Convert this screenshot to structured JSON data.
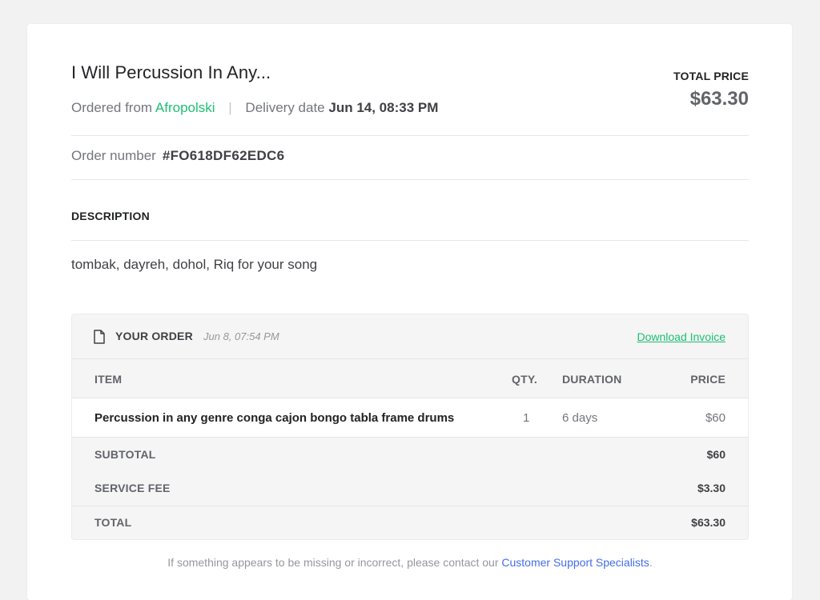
{
  "order": {
    "title": "I Will Percussion In Any...",
    "ordered_from_label": "Ordered from",
    "seller": "Afropolski",
    "separator": "|",
    "delivery_label": "Delivery date",
    "delivery_date": "Jun 14, 08:33 PM",
    "total_price_label": "TOTAL PRICE",
    "total_price": "$63.30",
    "order_number_label": "Order number",
    "order_number": "#FO618DF62EDC6"
  },
  "description": {
    "heading": "DESCRIPTION",
    "text": "tombak, dayreh, dohol, Riq for your song"
  },
  "your_order": {
    "heading": "YOUR ORDER",
    "date": "Jun 8, 07:54 PM",
    "download_label": "Download Invoice",
    "columns": {
      "item": "ITEM",
      "qty": "QTY.",
      "duration": "DURATION",
      "price": "PRICE"
    },
    "items": [
      {
        "name": "Percussion in any genre conga cajon bongo tabla frame drums",
        "qty": "1",
        "duration": "6 days",
        "price": "$60"
      }
    ],
    "subtotal_label": "SUBTOTAL",
    "subtotal": "$60",
    "service_fee_label": "SERVICE FEE",
    "service_fee": "$3.30",
    "total_label": "TOTAL",
    "total": "$63.30"
  },
  "footer": {
    "text": "If something appears to be missing or incorrect, please contact our",
    "link": "Customer Support Specialists",
    "suffix": "."
  },
  "colors": {
    "accent_green": "#1dbf73",
    "link_blue": "#446ee7"
  },
  "icons": {
    "order_doc": "document-icon"
  }
}
